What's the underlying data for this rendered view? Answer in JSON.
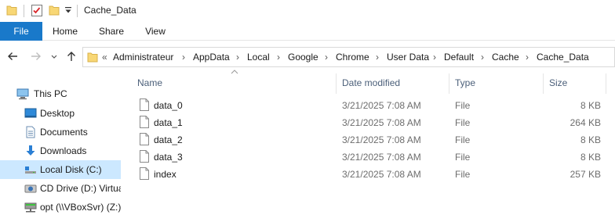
{
  "window": {
    "title": "Cache_Data"
  },
  "ribbon": {
    "tabs": [
      {
        "label": "File"
      },
      {
        "label": "Home"
      },
      {
        "label": "Share"
      },
      {
        "label": "View"
      }
    ]
  },
  "colors": {
    "accent": "#1979ca",
    "selected": "#cce8ff",
    "folder": "#f8d775"
  },
  "address": {
    "overflow": "«",
    "crumbs": [
      "Administrateur",
      "AppData",
      "Local",
      "Google",
      "Chrome",
      "User Data",
      "Default",
      "Cache",
      "Cache_Data"
    ]
  },
  "nav": {
    "items": [
      {
        "label": "This PC",
        "icon": "computer-icon"
      },
      {
        "label": "Desktop",
        "icon": "desktop-icon"
      },
      {
        "label": "Documents",
        "icon": "documents-icon"
      },
      {
        "label": "Downloads",
        "icon": "downloads-icon"
      },
      {
        "label": "Local Disk (C:)",
        "icon": "drive-icon"
      },
      {
        "label": "CD Drive (D:) Virtua",
        "icon": "cd-drive-icon"
      },
      {
        "label": "opt (\\\\VBoxSvr) (Z:)",
        "icon": "network-drive-icon"
      }
    ]
  },
  "list": {
    "columns": {
      "name": "Name",
      "date": "Date modified",
      "type": "Type",
      "size": "Size"
    },
    "rows": [
      {
        "name": "data_0",
        "date": "3/21/2025 7:08 AM",
        "type": "File",
        "size": "8 KB"
      },
      {
        "name": "data_1",
        "date": "3/21/2025 7:08 AM",
        "type": "File",
        "size": "264 KB"
      },
      {
        "name": "data_2",
        "date": "3/21/2025 7:08 AM",
        "type": "File",
        "size": "8 KB"
      },
      {
        "name": "data_3",
        "date": "3/21/2025 7:08 AM",
        "type": "File",
        "size": "8 KB"
      },
      {
        "name": "index",
        "date": "3/21/2025 7:08 AM",
        "type": "File",
        "size": "257 KB"
      }
    ]
  }
}
